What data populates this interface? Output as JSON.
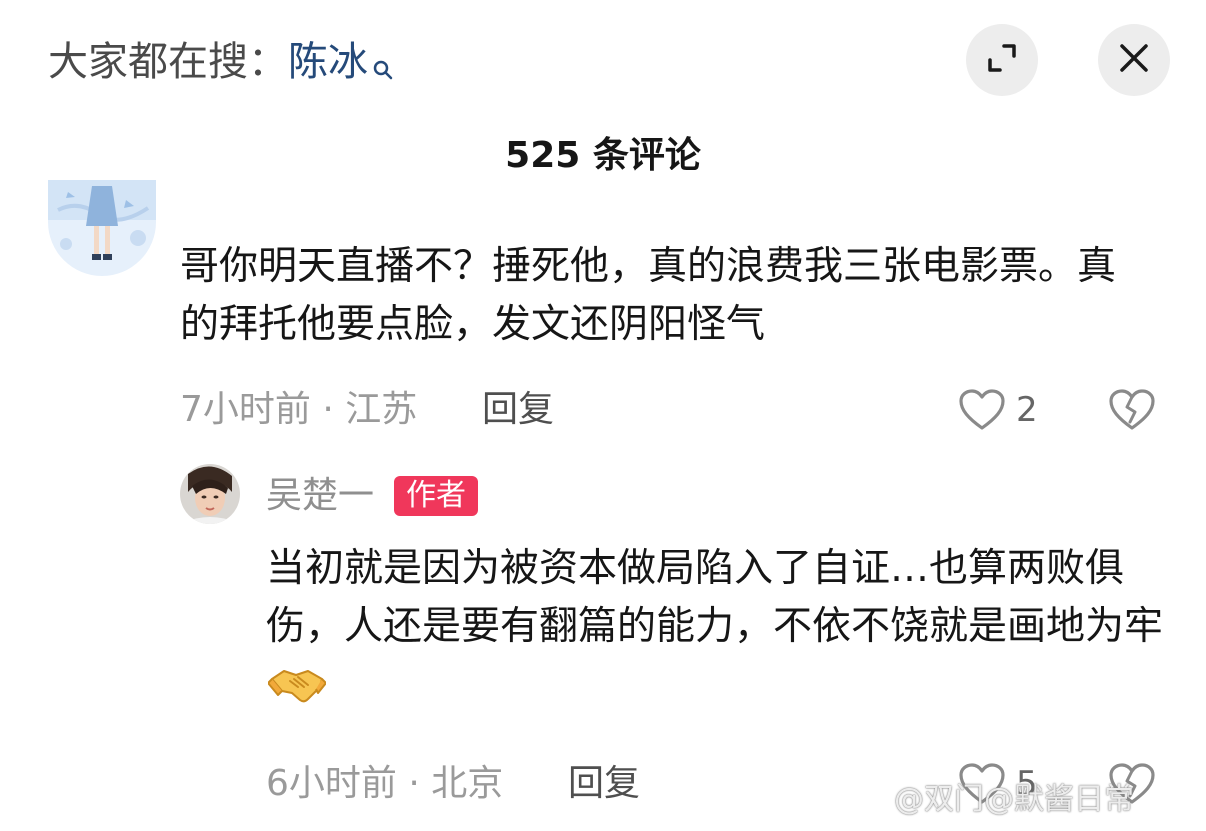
{
  "header": {
    "search_prefix": "大家都在搜：",
    "search_term": "陈冰",
    "search_icon": "search-icon",
    "expand_icon": "expand-icon",
    "close_icon": "close-icon"
  },
  "comments_header": {
    "count_label": "525 条评论"
  },
  "comments": [
    {
      "text": "哥你明天直播不？捶死他，真的浪费我三张电影票。真的拜托他要点脸，发文还阴阳怪气",
      "meta": "7小时前 · 江苏",
      "reply_label": "回复",
      "like_count": "2"
    }
  ],
  "reply": {
    "author": "吴楚一",
    "badge": "作者",
    "text": "当初就是因为被资本做局陷入了自证…也算两败俱伤，人还是要有翻篇的能力，不依不饶就是画地为牢",
    "emoji_icon": "handshake-icon",
    "meta": "6小时前 · 北京",
    "reply_label": "回复",
    "like_count": "5"
  },
  "watermark": "@双门@默酱日常",
  "colors": {
    "badge_bg": "#f0375b",
    "search_term": "#254a7a",
    "muted_text": "#9a9a9a"
  }
}
